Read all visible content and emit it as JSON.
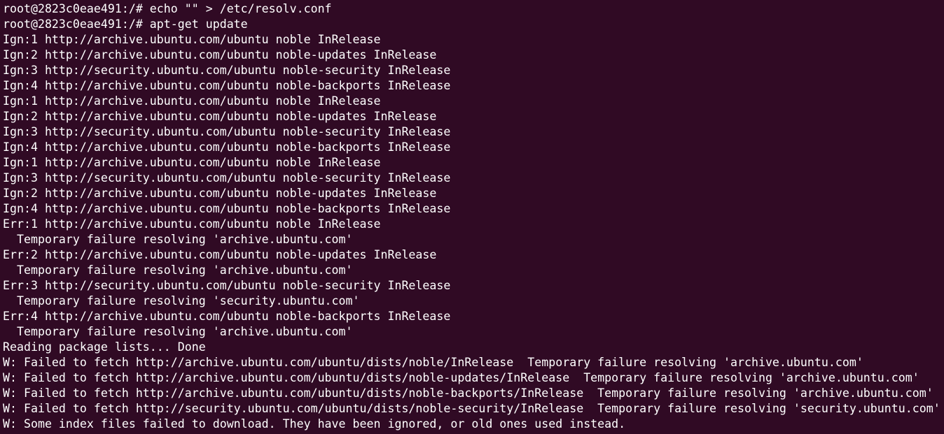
{
  "terminal": {
    "background": "#300a24",
    "foreground": "#ffffff",
    "lines": [
      "root@2823c0eae491:/# echo \"\" > /etc/resolv.conf",
      "root@2823c0eae491:/# apt-get update",
      "Ign:1 http://archive.ubuntu.com/ubuntu noble InRelease",
      "Ign:2 http://archive.ubuntu.com/ubuntu noble-updates InRelease",
      "Ign:3 http://security.ubuntu.com/ubuntu noble-security InRelease",
      "Ign:4 http://archive.ubuntu.com/ubuntu noble-backports InRelease",
      "Ign:1 http://archive.ubuntu.com/ubuntu noble InRelease",
      "Ign:2 http://archive.ubuntu.com/ubuntu noble-updates InRelease",
      "Ign:3 http://security.ubuntu.com/ubuntu noble-security InRelease",
      "Ign:4 http://archive.ubuntu.com/ubuntu noble-backports InRelease",
      "Ign:1 http://archive.ubuntu.com/ubuntu noble InRelease",
      "Ign:3 http://security.ubuntu.com/ubuntu noble-security InRelease",
      "Ign:2 http://archive.ubuntu.com/ubuntu noble-updates InRelease",
      "Ign:4 http://archive.ubuntu.com/ubuntu noble-backports InRelease",
      "Err:1 http://archive.ubuntu.com/ubuntu noble InRelease",
      "  Temporary failure resolving 'archive.ubuntu.com'",
      "Err:2 http://archive.ubuntu.com/ubuntu noble-updates InRelease",
      "  Temporary failure resolving 'archive.ubuntu.com'",
      "Err:3 http://security.ubuntu.com/ubuntu noble-security InRelease",
      "  Temporary failure resolving 'security.ubuntu.com'",
      "Err:4 http://archive.ubuntu.com/ubuntu noble-backports InRelease",
      "  Temporary failure resolving 'archive.ubuntu.com'",
      "Reading package lists... Done",
      "W: Failed to fetch http://archive.ubuntu.com/ubuntu/dists/noble/InRelease  Temporary failure resolving 'archive.ubuntu.com'",
      "W: Failed to fetch http://archive.ubuntu.com/ubuntu/dists/noble-updates/InRelease  Temporary failure resolving 'archive.ubuntu.com'",
      "W: Failed to fetch http://archive.ubuntu.com/ubuntu/dists/noble-backports/InRelease  Temporary failure resolving 'archive.ubuntu.com'",
      "W: Failed to fetch http://security.ubuntu.com/ubuntu/dists/noble-security/InRelease  Temporary failure resolving 'security.ubuntu.com'",
      "W: Some index files failed to download. They have been ignored, or old ones used instead."
    ]
  }
}
